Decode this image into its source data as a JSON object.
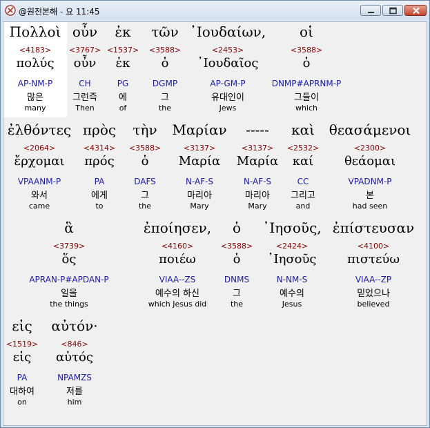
{
  "window": {
    "title": "@원전본해 - 요 11:45"
  },
  "icons": {
    "app": "app-logo-icon",
    "minimize": "minimize-icon",
    "maximize": "maximize-icon",
    "close": "close-icon"
  },
  "colors": {
    "strong": "#8b0000",
    "morph": "#1a1aa8",
    "selected_bg": "#ffffff"
  },
  "rows": [
    {
      "words": [
        {
          "greek": "Πολλοὶ",
          "strong": "<4183>",
          "lemma": "πολύς",
          "morph": "AP-NM-P",
          "korean": "많은",
          "english": "many",
          "selected": true
        },
        {
          "greek": "οὖν",
          "strong": "<3767>",
          "lemma": "οὖν",
          "morph": "CH",
          "korean": "그런즉",
          "english": "Then"
        },
        {
          "greek": "ἐκ",
          "strong": "<1537>",
          "lemma": "ἐκ",
          "morph": "PG",
          "korean": "에",
          "english": "of"
        },
        {
          "greek": "τῶν",
          "strong": "<3588>",
          "lemma": "ὁ",
          "morph": "DGMP",
          "korean": "그",
          "english": "the"
        },
        {
          "greek": "᾿Ιουδαίων,",
          "strong": "<2453>",
          "lemma": "᾿Ιουδαῖος",
          "morph": "AP-GM-P",
          "korean": "유대인이",
          "english": "Jews"
        },
        {
          "greek": "οἱ",
          "strong": "<3588>",
          "lemma": "ὁ",
          "morph": "DNMP#APRNM-P",
          "korean": "그들이",
          "english": "which"
        }
      ]
    },
    {
      "words": [
        {
          "greek": "ἐλθόντες",
          "strong": "<2064>",
          "lemma": "ἔρχομαι",
          "morph": "VPAANM-P",
          "korean": "와서",
          "english": "came"
        },
        {
          "greek": "πρὸς",
          "strong": "<4314>",
          "lemma": "πρός",
          "morph": "PA",
          "korean": "에게",
          "english": "to"
        },
        {
          "greek": "τὴν",
          "strong": "<3588>",
          "lemma": "ὁ",
          "morph": "DAFS",
          "korean": "그",
          "english": "the"
        },
        {
          "greek": "Μαρίαν",
          "strong": "<3137>",
          "lemma": "Μαρία",
          "morph": "N-AF-S",
          "korean": "마리아",
          "english": "Mary"
        },
        {
          "greek": "-----",
          "strong": "<3137>",
          "lemma": "Μαρία",
          "morph": "N-AF-S",
          "korean": "마리아",
          "english": "Mary"
        },
        {
          "greek": "καὶ",
          "strong": "<2532>",
          "lemma": "καί",
          "morph": "CC",
          "korean": "그리고",
          "english": "and"
        },
        {
          "greek": "θεασάμενοι",
          "strong": "<2300>",
          "lemma": "θεάομαι",
          "morph": "VPADNM-P",
          "korean": "본",
          "english": "had seen"
        }
      ]
    },
    {
      "words": [
        {
          "greek": "ἃ",
          "strong": "<3739>",
          "lemma": "ὅς",
          "morph": "APRAN-P#APDAN-P",
          "korean": "일을",
          "english": "the things"
        },
        {
          "greek": "ἐποίησεν,",
          "strong": "<4160>",
          "lemma": "ποιέω",
          "morph": "VIAA--ZS",
          "korean": "예수의 하신",
          "english": "which Jesus did"
        },
        {
          "greek": "ὁ",
          "strong": "<3588>",
          "lemma": "ὁ",
          "morph": "DNMS",
          "korean": "그",
          "english": "the"
        },
        {
          "greek": "᾿Ιησοῦς,",
          "strong": "<2424>",
          "lemma": "᾿Ιησοῦς",
          "morph": "N-NM-S",
          "korean": "예수의",
          "english": "Jesus"
        },
        {
          "greek": "ἐπίστευσαν",
          "strong": "<4100>",
          "lemma": "πιστεύω",
          "morph": "VIAA--ZP",
          "korean": "믿었으나",
          "english": "believed"
        }
      ]
    },
    {
      "words": [
        {
          "greek": "εἰς",
          "strong": "<1519>",
          "lemma": "εἰς",
          "morph": "PA",
          "korean": "대하여",
          "english": "on"
        },
        {
          "greek": "αὐτόν·",
          "strong": "<846>",
          "lemma": "αὐτός",
          "morph": "NPAMZS",
          "korean": "저를",
          "english": "him"
        }
      ]
    }
  ]
}
